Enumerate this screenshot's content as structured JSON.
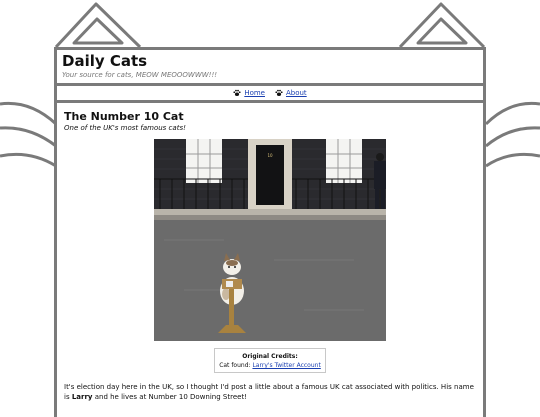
{
  "site": {
    "title": "Daily Cats",
    "tagline": "Your source for cats, MEOW MEOOOWWW!!!"
  },
  "nav": {
    "items": [
      {
        "label": "Home",
        "icon": "paw-icon"
      },
      {
        "label": "About",
        "icon": "paw-icon"
      }
    ]
  },
  "post": {
    "title": "The Number 10 Cat",
    "subtitle": "One of the UK's most famous cats!",
    "image_alt": "Larry the cat sitting on the street in front of the door of Number 10 Downing Street",
    "credits": {
      "heading": "Original Credits:",
      "prefix": "Cat found:",
      "link_text": "Larry's Twitter Account"
    },
    "body_before": "It's election day here in the UK, so I thought I'd post a little about a famous UK cat associated with politics. His name is",
    "name": "Larry",
    "body_after": "and he lives at Number 10 Downing Street!"
  },
  "colors": {
    "frame": "#7a7a7a",
    "link": "#1a3fb0"
  }
}
